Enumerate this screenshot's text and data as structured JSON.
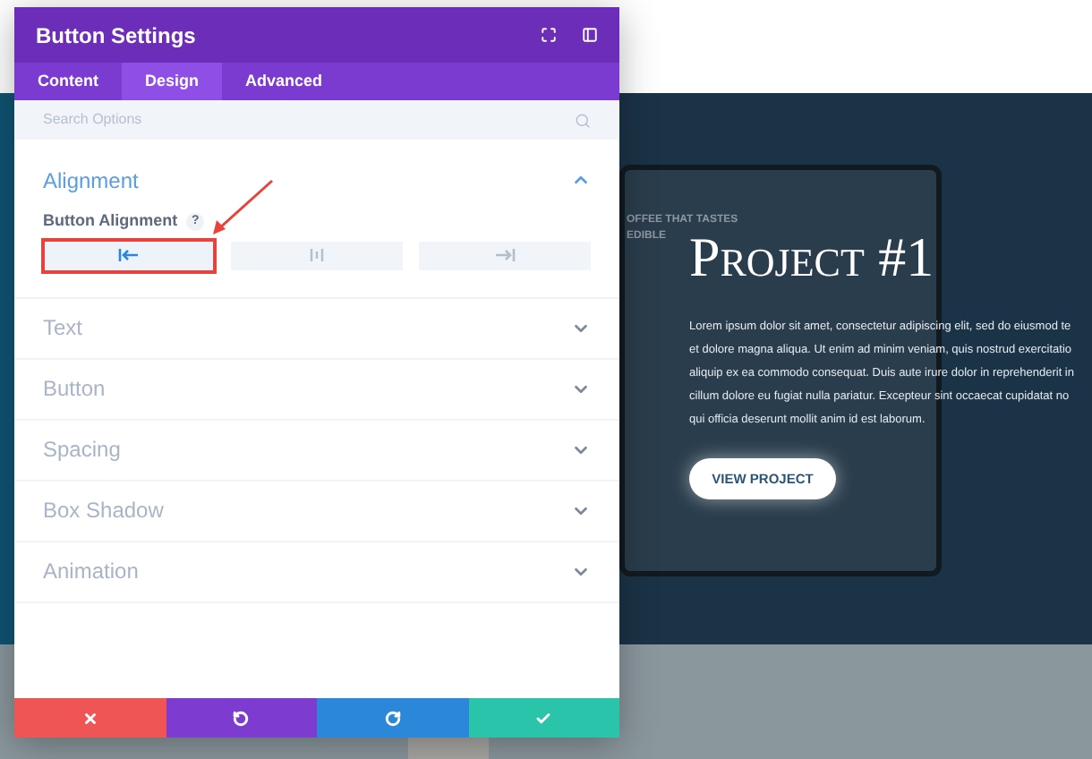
{
  "modal": {
    "title": "Button Settings",
    "tabs": [
      {
        "label": "Content",
        "selected": false
      },
      {
        "label": "Design",
        "selected": true
      },
      {
        "label": "Advanced",
        "selected": false
      }
    ],
    "search": {
      "placeholder": "Search Options"
    },
    "sections": [
      {
        "title": "Alignment",
        "expanded": true,
        "field": {
          "label": "Button Alignment",
          "help": "?",
          "options": [
            {
              "kind": "left",
              "selected": true
            },
            {
              "kind": "center",
              "selected": false
            },
            {
              "kind": "right",
              "selected": false
            }
          ]
        }
      },
      {
        "title": "Text",
        "expanded": false
      },
      {
        "title": "Button",
        "expanded": false
      },
      {
        "title": "Spacing",
        "expanded": false
      },
      {
        "title": "Box Shadow",
        "expanded": false
      },
      {
        "title": "Animation",
        "expanded": false
      }
    ],
    "footer": [
      {
        "kind": "cancel"
      },
      {
        "kind": "undo"
      },
      {
        "kind": "redo"
      },
      {
        "kind": "save"
      }
    ]
  },
  "hero": {
    "laptop_screen": [
      "OFFEE THAT TASTES",
      "EDIBLE"
    ],
    "title": "Project #1",
    "body": [
      "Lorem ipsum dolor sit amet, consectetur adipiscing elit, sed do eiusmod te",
      "et dolore magna aliqua. Ut enim ad minim veniam, quis nostrud exercitatio",
      "aliquip ex ea commodo consequat. Duis aute irure dolor in reprehenderit in",
      "cillum dolore eu fugiat nulla pariatur. Excepteur sint occaecat cupidatat no",
      "qui officia deserunt mollit anim id est laborum."
    ],
    "button": "VIEW PROJECT"
  }
}
